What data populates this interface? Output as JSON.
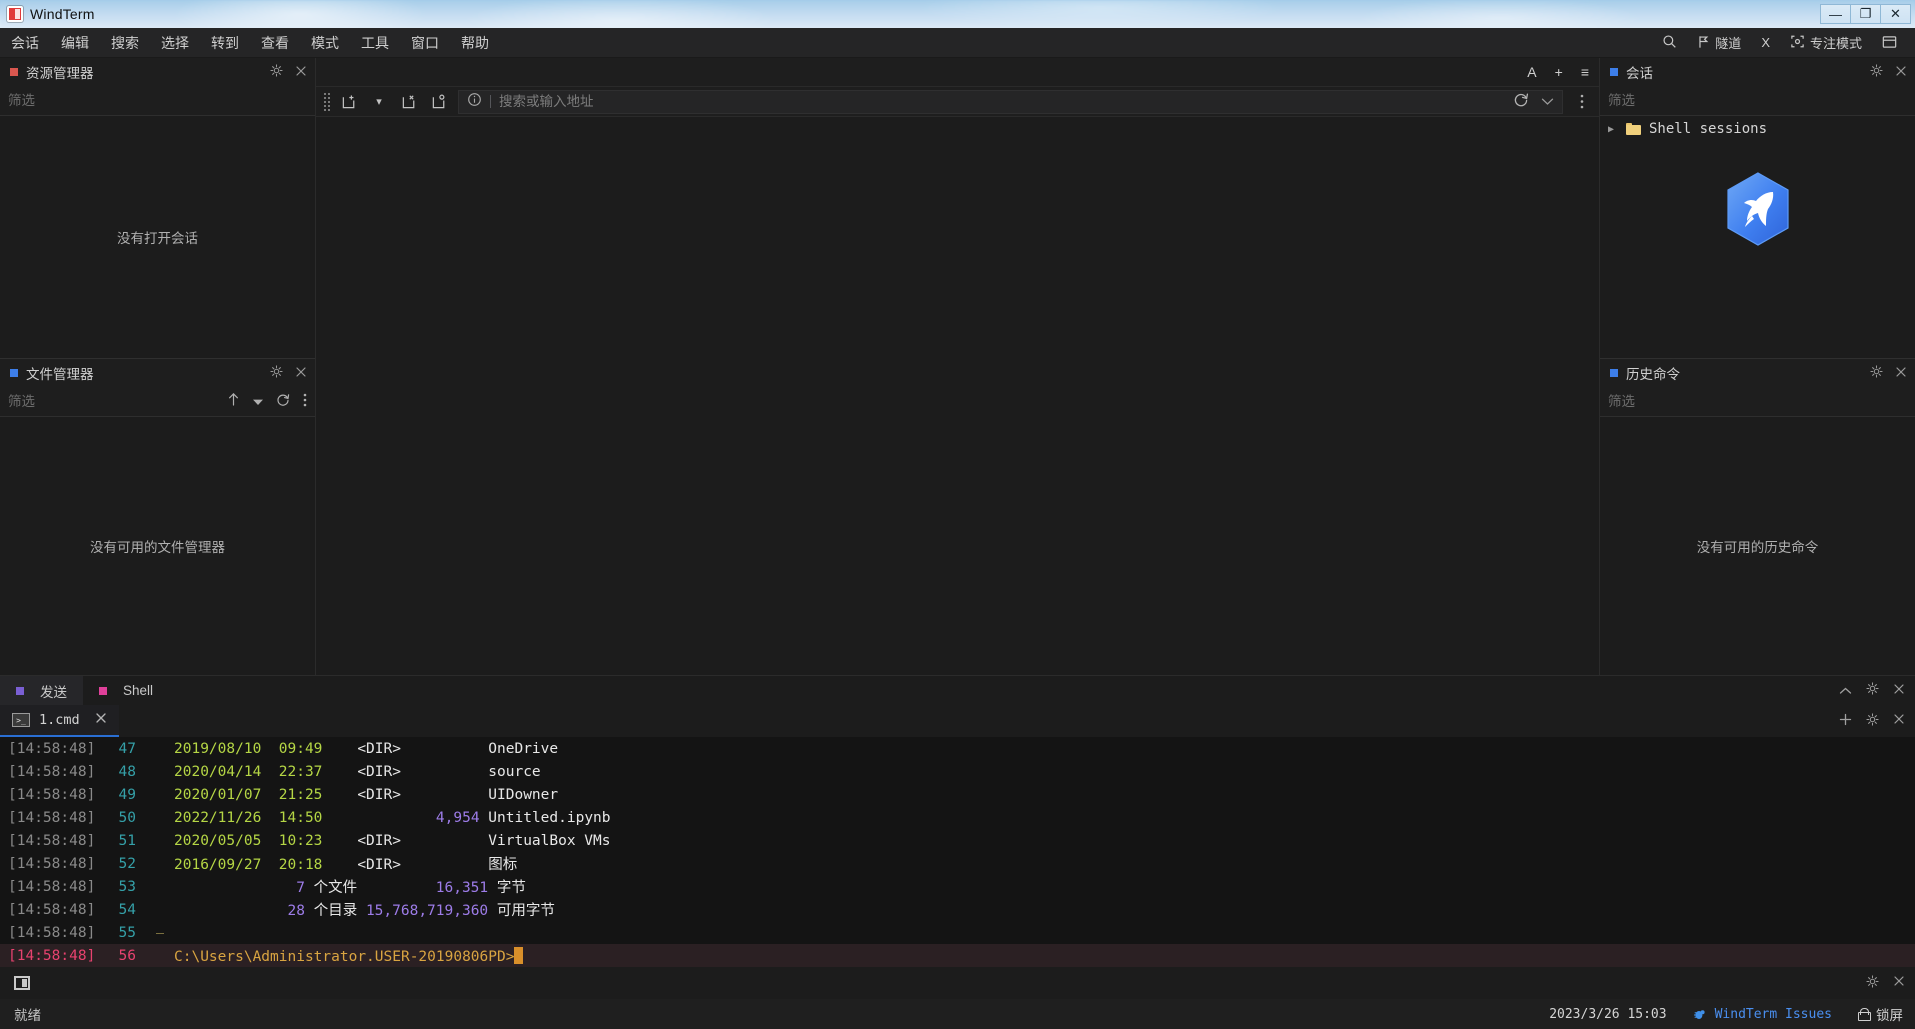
{
  "titlebar": {
    "app_name": "WindTerm",
    "minimize": "—",
    "maximize": "❐",
    "close": "✕"
  },
  "menubar": {
    "items": [
      "会话",
      "编辑",
      "搜索",
      "选择",
      "转到",
      "查看",
      "模式",
      "工具",
      "窗口",
      "帮助"
    ],
    "right": {
      "search_icon": "search-icon",
      "tunnel_label": "隧道",
      "x_label": "X",
      "focus_label": "专注模式",
      "layout_icon": "layout-icon"
    }
  },
  "left_dock": {
    "explorer": {
      "title": "资源管理器",
      "filter_placeholder": "筛选",
      "filter_value": "",
      "empty_message": "没有打开会话",
      "bullet_color": "#d9574f"
    },
    "file_manager": {
      "title": "文件管理器",
      "filter_placeholder": "筛选",
      "filter_value": "",
      "empty_message": "没有可用的文件管理器",
      "bullet_color": "#3d7ee8"
    }
  },
  "center": {
    "tabbar": {
      "font_icon": "A",
      "add_icon": "+",
      "menu_icon": "≡"
    },
    "toolbar": {
      "new_tab_icon": "new-tab-icon",
      "dropdown_icon": "▾",
      "close_tab_icon": "close-tab-icon",
      "restore_tab_icon": "restore-tab-icon",
      "info_icon": "ⓘ",
      "address_placeholder": "搜索或输入地址",
      "address_value": "",
      "refresh_icon": "refresh-icon",
      "chevron_icon": "⌄",
      "more_icon": "⋮"
    }
  },
  "right_dock": {
    "sessions": {
      "title": "会话",
      "filter_placeholder": "筛选",
      "filter_value": "",
      "tree": [
        {
          "label": "Shell sessions",
          "icon": "folder-icon",
          "caret": "▶"
        }
      ],
      "bullet_color": "#3d7ee8"
    },
    "history": {
      "title": "历史命令",
      "filter_placeholder": "筛选",
      "filter_value": "",
      "empty_message": "没有可用的历史命令",
      "bullet_color": "#3d7ee8"
    }
  },
  "bottom_dock": {
    "tabs": [
      {
        "label": "发送",
        "bullet": "purple",
        "active": true
      },
      {
        "label": "Shell",
        "bullet": "pink",
        "active": false
      }
    ],
    "panel_actions": {
      "collapse_icon": "⌃",
      "gear_icon": "gear-icon",
      "close_icon": "✕"
    },
    "subtab": {
      "label": "1.cmd",
      "icon": "cmd-icon",
      "close": "✕"
    },
    "subtab_actions": {
      "add_icon": "+",
      "gear_icon": "gear-icon",
      "close_icon": "✕"
    },
    "terminal": {
      "lines": [
        {
          "ts": "[14:58:48]",
          "ln": "47",
          "gutter": "line",
          "segs": [
            {
              "t": "2019/08/10  09:49",
              "c": "c-date"
            },
            {
              "t": "    <DIR>          ",
              "c": "c-dir"
            },
            {
              "t": "OneDrive",
              "c": "c-name"
            }
          ]
        },
        {
          "ts": "[14:58:48]",
          "ln": "48",
          "gutter": "line",
          "segs": [
            {
              "t": "2020/04/14  22:37",
              "c": "c-date"
            },
            {
              "t": "    <DIR>          ",
              "c": "c-dir"
            },
            {
              "t": "source",
              "c": "c-name"
            }
          ]
        },
        {
          "ts": "[14:58:48]",
          "ln": "49",
          "gutter": "line",
          "segs": [
            {
              "t": "2020/01/07  21:25",
              "c": "c-date"
            },
            {
              "t": "    <DIR>          ",
              "c": "c-dir"
            },
            {
              "t": "UIDowner",
              "c": "c-name"
            }
          ]
        },
        {
          "ts": "[14:58:48]",
          "ln": "50",
          "gutter": "line",
          "segs": [
            {
              "t": "2022/11/26  14:50",
              "c": "c-date"
            },
            {
              "t": "             ",
              "c": "c-dir"
            },
            {
              "t": "4,954",
              "c": "c-size"
            },
            {
              "t": " Untitled.ipynb",
              "c": "c-name"
            }
          ]
        },
        {
          "ts": "[14:58:48]",
          "ln": "51",
          "gutter": "line",
          "segs": [
            {
              "t": "2020/05/05  10:23",
              "c": "c-date"
            },
            {
              "t": "    <DIR>          ",
              "c": "c-dir"
            },
            {
              "t": "VirtualBox VMs",
              "c": "c-name"
            }
          ]
        },
        {
          "ts": "[14:58:48]",
          "ln": "52",
          "gutter": "line",
          "segs": [
            {
              "t": "2016/09/27  20:18",
              "c": "c-date"
            },
            {
              "t": "    <DIR>          ",
              "c": "c-dir"
            },
            {
              "t": "图标",
              "c": "c-name"
            }
          ]
        },
        {
          "ts": "[14:58:48]",
          "ln": "53",
          "gutter": "line",
          "segs": [
            {
              "t": "              ",
              "c": "c-name"
            },
            {
              "t": "7",
              "c": "c-num"
            },
            {
              "t": " 个文件         ",
              "c": "c-name"
            },
            {
              "t": "16,351",
              "c": "c-num"
            },
            {
              "t": " 字节",
              "c": "c-name"
            }
          ]
        },
        {
          "ts": "[14:58:48]",
          "ln": "54",
          "gutter": "line",
          "segs": [
            {
              "t": "             ",
              "c": "c-name"
            },
            {
              "t": "28",
              "c": "c-num"
            },
            {
              "t": " 个目录 ",
              "c": "c-name"
            },
            {
              "t": "15,768,719,360",
              "c": "c-num"
            },
            {
              "t": " 可用字节",
              "c": "c-name"
            }
          ]
        },
        {
          "ts": "[14:58:48]",
          "ln": "55",
          "gutter": "elbow",
          "segs": []
        },
        {
          "ts": "[14:58:48]",
          "ln": "56",
          "gutter": "none",
          "current": true,
          "segs": [
            {
              "t": "C:\\Users\\Administrator.USER-20190806PD>",
              "c": "c-prompt"
            }
          ],
          "cursor": true
        }
      ]
    }
  },
  "statusbar": {
    "window_icon": "window-icon",
    "gear_icon": "gear-icon",
    "close_icon": "✕",
    "ready_label": "就绪",
    "datetime": "2023/3/26 15:03",
    "issues_label": "WindTerm Issues",
    "lock_label": "锁屏"
  }
}
